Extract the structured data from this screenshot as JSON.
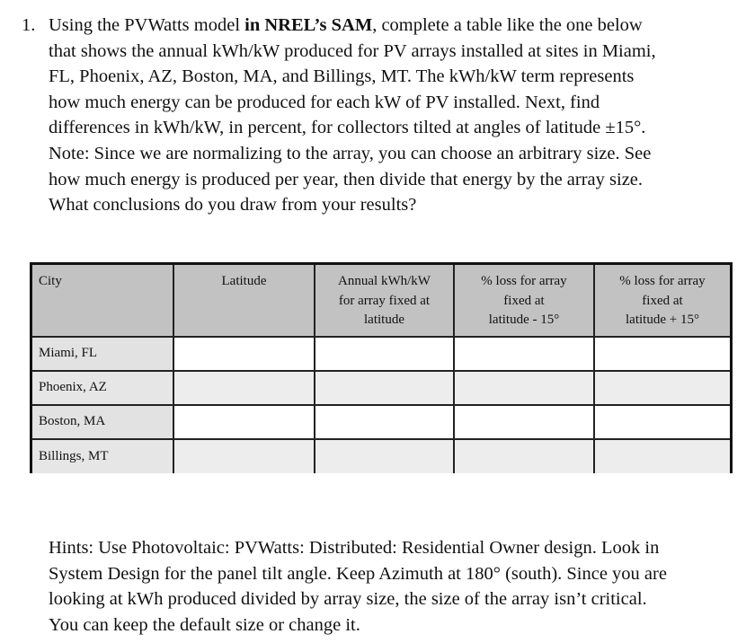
{
  "question": {
    "number": "1.",
    "lines": [
      {
        "pre": "Using the PVWatts model ",
        "bold": "in NREL’s SAM",
        "post": ", complete a table like the one below"
      },
      {
        "pre": "that shows the annual kWh/kW produced for PV arrays installed at sites in Miami,",
        "bold": "",
        "post": ""
      },
      {
        "pre": "FL, Phoenix, AZ, Boston, MA, and Billings, MT. The kWh/kW term represents",
        "bold": "",
        "post": ""
      },
      {
        "pre": "how much energy can be produced for each kW of PV installed. Next, find",
        "bold": "",
        "post": ""
      },
      {
        "pre": "differences in kWh/kW, in percent, for collectors tilted at angles of latitude ±15°.",
        "bold": "",
        "post": ""
      },
      {
        "pre": "Note: Since we are normalizing to the array, you can choose an arbitrary size. See",
        "bold": "",
        "post": ""
      },
      {
        "pre": "how much energy is produced per year, then divide that energy by the array size.",
        "bold": "",
        "post": ""
      },
      {
        "pre": "What conclusions do you draw from your results?",
        "bold": "",
        "post": ""
      }
    ]
  },
  "table": {
    "headers": [
      [
        "City"
      ],
      [
        "Latitude"
      ],
      [
        "Annual kWh/kW",
        "for array fixed at",
        "latitude"
      ],
      [
        "% loss for array",
        "fixed at",
        "latitude - 15°"
      ],
      [
        "% loss for array",
        "fixed at",
        "latitude + 15°"
      ]
    ],
    "rows": [
      {
        "city": "Miami, FL",
        "latitude": "",
        "annual": "",
        "loss_minus": "",
        "loss_plus": ""
      },
      {
        "city": "Phoenix, AZ",
        "latitude": "",
        "annual": "",
        "loss_minus": "",
        "loss_plus": ""
      },
      {
        "city": "Boston, MA",
        "latitude": "",
        "annual": "",
        "loss_minus": "",
        "loss_plus": ""
      },
      {
        "city": "Billings, MT",
        "latitude": "",
        "annual": "",
        "loss_minus": "",
        "loss_plus": ""
      }
    ]
  },
  "hints": {
    "lines": [
      "Hints: Use Photovoltaic: PVWatts: Distributed: Residential Owner design. Look in",
      "System Design for the panel tilt angle. Keep Azimuth at 180° (south). Since you are",
      "looking at kWh produced divided by array size, the size of the array isn’t critical.",
      "You can keep the default size or change it."
    ]
  }
}
